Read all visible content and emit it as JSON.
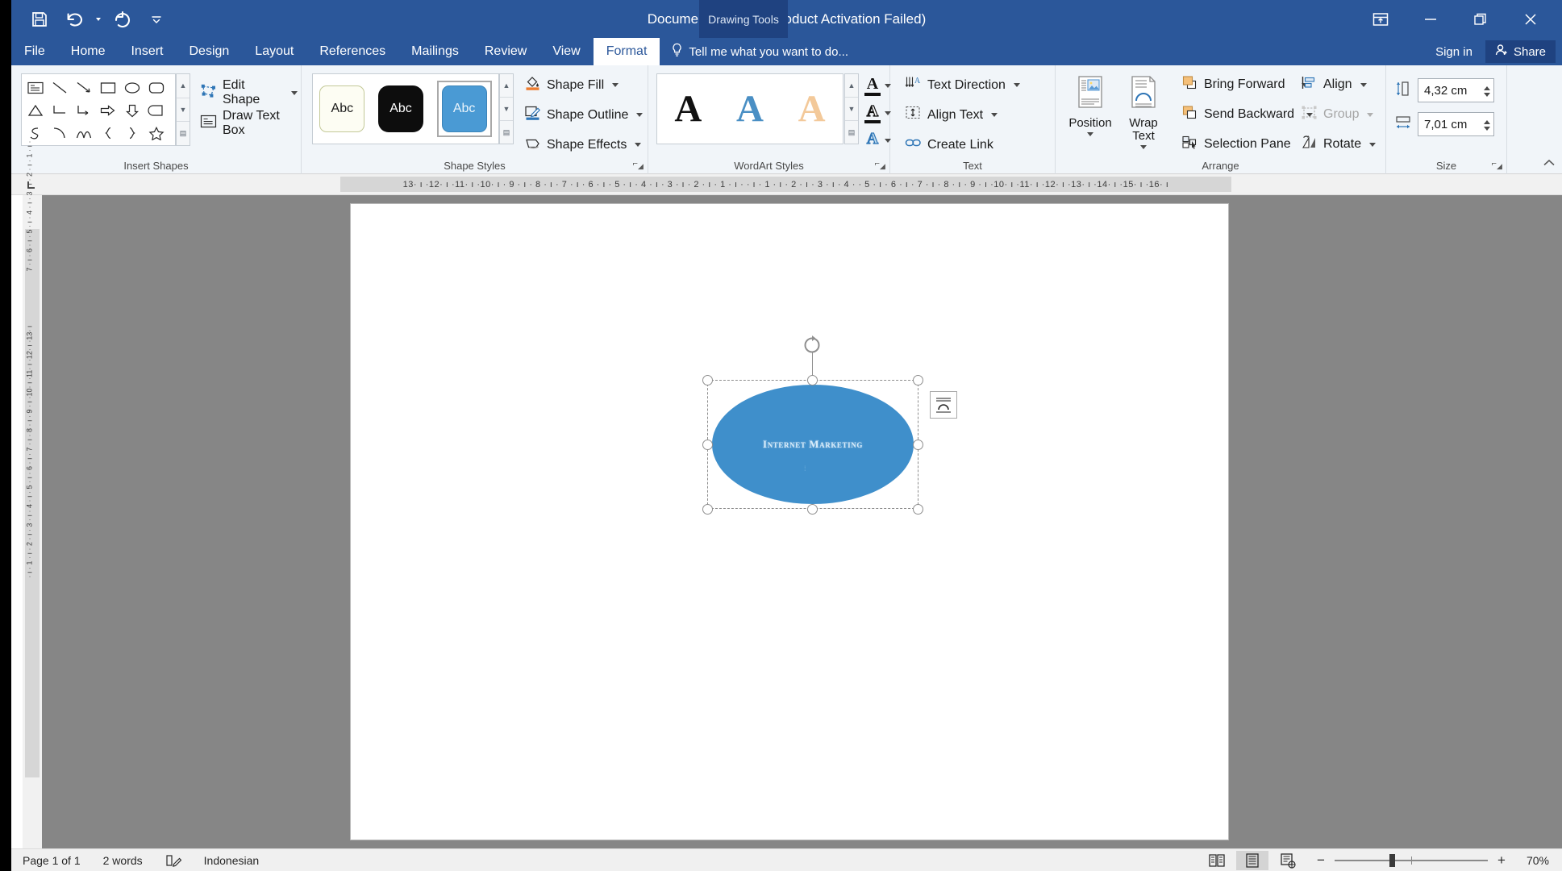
{
  "window": {
    "title": "Document1 - Word (Product Activation Failed)",
    "contextual_tab_label": "Drawing Tools",
    "quick_access": [
      {
        "name": "save",
        "icon": "save-icon"
      },
      {
        "name": "undo",
        "icon": "undo-icon"
      },
      {
        "name": "redo",
        "icon": "redo-icon"
      },
      {
        "name": "customize",
        "icon": "qat-dropdown-icon"
      }
    ],
    "controls": {
      "ribbon_display": "ribbon-display-options-icon",
      "minimize": "minimize-icon",
      "restore": "restore-icon",
      "close": "close-icon"
    }
  },
  "tabs": [
    {
      "label": "File",
      "active": false
    },
    {
      "label": "Home",
      "active": false
    },
    {
      "label": "Insert",
      "active": false
    },
    {
      "label": "Design",
      "active": false
    },
    {
      "label": "Layout",
      "active": false
    },
    {
      "label": "References",
      "active": false
    },
    {
      "label": "Mailings",
      "active": false
    },
    {
      "label": "Review",
      "active": false
    },
    {
      "label": "View",
      "active": false
    },
    {
      "label": "Format",
      "active": true
    }
  ],
  "tell_me": "Tell me what you want to do...",
  "account": {
    "sign_in": "Sign in",
    "share": "Share"
  },
  "ribbon": {
    "groups": [
      {
        "label": "Insert Shapes",
        "launcher": false
      },
      {
        "label": "Shape Styles",
        "launcher": true
      },
      {
        "label": "WordArt Styles",
        "launcher": true
      },
      {
        "label": "Text",
        "launcher": false
      },
      {
        "label": "Arrange",
        "launcher": false
      },
      {
        "label": "Size",
        "launcher": true
      }
    ],
    "insert_shapes": {
      "edit_shape": "Edit Shape",
      "draw_text_box": "Draw Text Box",
      "gallery_rows": [
        [
          "text-box-shape",
          "line-shape",
          "line-arrow-shape",
          "rectangle-shape",
          "oval-shape",
          "rounded-rectangle-shape"
        ],
        [
          "triangle-shape",
          "elbow-connector-shape",
          "elbow-arrow-connector-shape",
          "right-arrow-shape",
          "down-arrow-shape",
          "flowchart-shape"
        ],
        [
          "scribble-shape",
          "arc-shape",
          "curve-shape",
          "left-brace-shape",
          "right-brace-shape",
          "star-shape"
        ]
      ]
    },
    "shape_styles": {
      "thumbnails": [
        {
          "label": "Abc",
          "name": "shape-style-subtle-outline",
          "selected": false
        },
        {
          "label": "Abc",
          "name": "shape-style-dark-fill",
          "selected": false
        },
        {
          "label": "Abc",
          "name": "shape-style-colored-fill-blue",
          "selected": true
        }
      ],
      "shape_fill": "Shape Fill",
      "shape_outline": "Shape Outline",
      "shape_effects": "Shape Effects"
    },
    "wordart_styles": {
      "thumbnails": [
        {
          "label": "A",
          "name": "wordart-style-fill-black",
          "color": "#111111"
        },
        {
          "label": "A",
          "name": "wordart-style-fill-blue",
          "color": "#4a8fc4"
        },
        {
          "label": "A",
          "name": "wordart-style-fill-orange",
          "color": "#f3c99a"
        }
      ],
      "buttons": [
        {
          "glyph": "A",
          "name": "text-fill-button",
          "color": "#111111"
        },
        {
          "glyph": "A",
          "name": "text-outline-button",
          "color": "#111111"
        },
        {
          "glyph": "A",
          "name": "text-effects-button",
          "color": "#2e75b6"
        }
      ]
    },
    "text": {
      "text_direction": "Text Direction",
      "align_text": "Align Text",
      "create_link": "Create Link"
    },
    "arrange": {
      "position": "Position",
      "wrap_text": "Wrap\nText",
      "wrap_text_line1": "Wrap",
      "wrap_text_line2": "Text",
      "bring_forward": "Bring Forward",
      "send_backward": "Send Backward",
      "selection_pane": "Selection Pane",
      "align": "Align",
      "group": "Group",
      "group_disabled": true,
      "rotate": "Rotate"
    },
    "size": {
      "height_label": "shape-height-icon",
      "height_value": "4,32 cm",
      "width_label": "shape-width-icon",
      "width_value": "7,01 cm"
    },
    "collapse": "collapse-ribbon-icon"
  },
  "rulers": {
    "horizontal": "13· ı ·12· ı ·11· ı ·10· ı · 9 · ı · 8 · ı · 7 · ı · 6 · ı · 5 · ı · 4 · ı · 3 · ı · 2 · ı · 1 · ı ·     · ı · 1 · ı · 2 · ı · 3 · ı · 4 ·    · 5 · ı · 6 · ı · 7 · ı · 8 · ı · 9 · ı ·10· ı ·11· ı ·12· ı ·13· ı ·14· ı ·15· ı ·16· ı",
    "vertical_top": "7 · ı · 6 · ı · 5 · ı · 4 · ı · 3 · ı · 2 · ı · 1 · ı ·",
    "vertical_bottom": "· ı · 1 · ı · 2 · ı · 3 · ı · 4 · ı · 5 · ı · 6 · ı · 7 · ı · 8 · ı · 9 · ı ·10· ı ·11· ı ·12· ı ·13· ı",
    "tab_stop_selector": "left-tab-stop-icon"
  },
  "document": {
    "shape": {
      "text": "Internet Marketing",
      "fill_color": "#3f8fcb",
      "text_color": "#d8ecfa",
      "type": "oval",
      "selected": true,
      "handles": [
        "top-left",
        "top-center",
        "top-right",
        "middle-left",
        "middle-right",
        "bottom-left",
        "bottom-center",
        "bottom-right"
      ],
      "rotation_handle": "rotate-handle-icon",
      "layout_options_button": "layout-options-icon"
    }
  },
  "status_bar": {
    "page": "Page 1 of 1",
    "words": "2 words",
    "proofing_icon": "proofing-errors-icon",
    "language": "Indonesian",
    "views": [
      {
        "name": "read-mode-view-button",
        "icon": "read-mode-icon",
        "active": false
      },
      {
        "name": "print-layout-view-button",
        "icon": "print-layout-icon",
        "active": true
      },
      {
        "name": "web-layout-view-button",
        "icon": "web-layout-icon",
        "active": false
      }
    ],
    "zoom_out": "−",
    "zoom_in": "+",
    "zoom_level": "70%"
  }
}
